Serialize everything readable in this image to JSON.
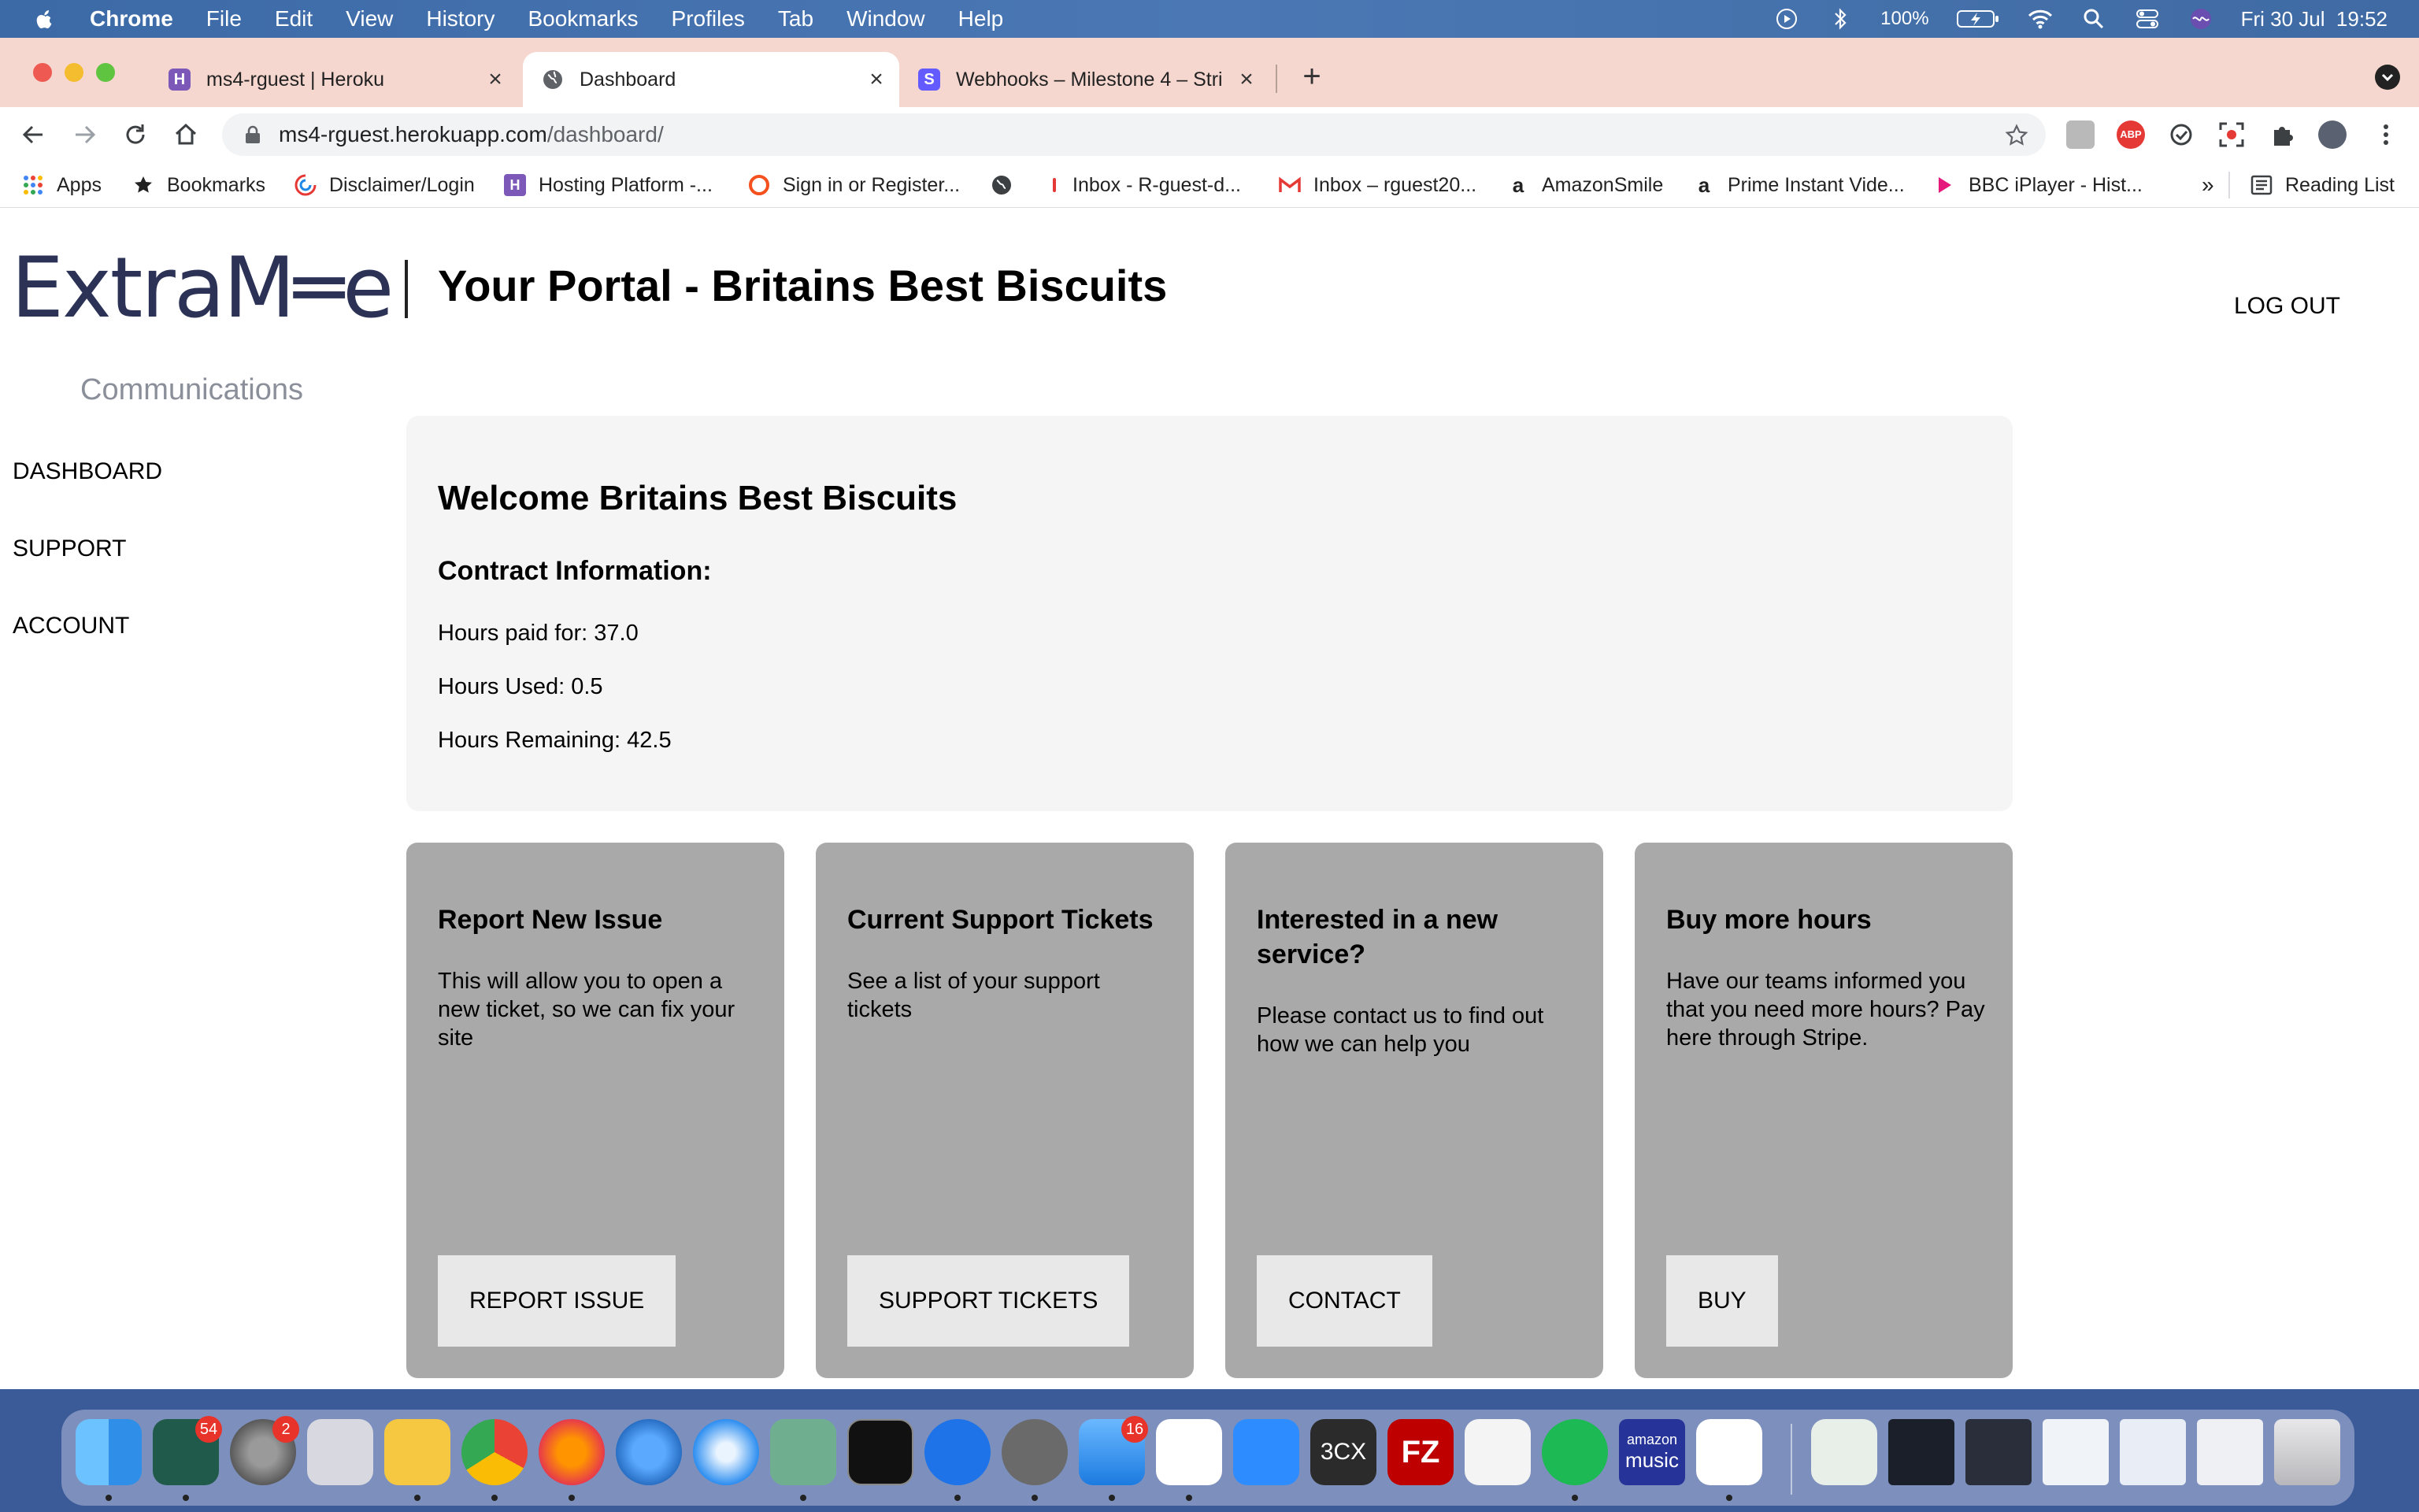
{
  "menubar": {
    "app_name": "Chrome",
    "items": [
      "File",
      "Edit",
      "View",
      "History",
      "Bookmarks",
      "Profiles",
      "Tab",
      "Window",
      "Help"
    ],
    "battery": "100%",
    "datetime": "Fri 30 Jul  19:52"
  },
  "tabs": [
    {
      "title": "ms4-rguest | Heroku",
      "favicon": "heroku-icon",
      "active": false
    },
    {
      "title": "Dashboard",
      "favicon": "globe-icon",
      "active": true
    },
    {
      "title": "Webhooks – Milestone 4 – Stri",
      "favicon": "stripe-icon",
      "active": false
    }
  ],
  "addressbar": {
    "url_host": "ms4-rguest.herokuapp.com",
    "url_path": "/dashboard/"
  },
  "bookmarks": {
    "items": [
      {
        "label": "Apps",
        "icon": "apps-grid-icon"
      },
      {
        "label": "Bookmarks",
        "icon": "star-icon"
      },
      {
        "label": "Disclaimer/Login",
        "icon": "disclaimer-icon"
      },
      {
        "label": "Hosting Platform -...",
        "icon": "hosting-icon"
      },
      {
        "label": "Sign in or Register...",
        "icon": "signin-icon"
      },
      {
        "label": "",
        "icon": "globe-icon"
      },
      {
        "label": "Inbox - R-guest-d...",
        "icon": "inbox-icon"
      },
      {
        "label": "Inbox – rguest20...",
        "icon": "gmail-icon"
      },
      {
        "label": "AmazonSmile",
        "icon": "amazon-icon"
      },
      {
        "label": "Prime Instant Vide...",
        "icon": "amazon-icon"
      },
      {
        "label": "BBC iPlayer - Hist...",
        "icon": "iplayer-icon"
      }
    ],
    "overflow": "»",
    "reading_list": "Reading List"
  },
  "page": {
    "logo_text": "ExtraM═e",
    "logo_subtext": "Communications",
    "title": "Your Portal - Britains Best Biscuits",
    "logout_label": "LOG OUT",
    "nav": [
      "DASHBOARD",
      "SUPPORT",
      "ACCOUNT"
    ],
    "welcome": "Welcome Britains Best Biscuits",
    "contract_heading": "Contract Information:",
    "hours_paid": "Hours paid for: 37.0",
    "hours_used": "Hours Used: 0.5",
    "hours_remaining": "Hours Remaining: 42.5",
    "cards": [
      {
        "title": "Report New Issue",
        "text": "This will allow you to open a new ticket, so we can fix your site",
        "button": "REPORT ISSUE"
      },
      {
        "title": "Current Support Tickets",
        "text": "See a list of your support tickets",
        "button": "SUPPORT TICKETS"
      },
      {
        "title": "Interested in a new service?",
        "text": "Please contact us to find out how we can help you",
        "button": "CONTACT"
      },
      {
        "title": "Buy more hours",
        "text": "Have our teams informed you that you need more hours? Pay here through Stripe.",
        "button": "BUY"
      }
    ]
  },
  "dock": {
    "badges": {
      "tasks": "54",
      "settings": "2",
      "mail": "16"
    },
    "apps": [
      "finder-icon",
      "tasks-icon",
      "system-prefs-icon",
      "launchpad-icon",
      "cyberduck-icon",
      "chrome-icon",
      "firefox-icon",
      "thunderbird-icon",
      "safari-icon",
      "atom-icon",
      "terminal-icon",
      "pinpoint-icon",
      "tableplus-icon",
      "mail-icon",
      "slack-icon",
      "zoom-icon",
      "3cx-icon",
      "filezilla-icon",
      "textedit-icon",
      "spotify-icon",
      "amazon-music-icon",
      "wps-icon"
    ],
    "icon_labels": {
      "3cx": "3CX",
      "filezilla": "FZ",
      "amazon_music_top": "amazon",
      "amazon_music_bottom": "music"
    }
  }
}
